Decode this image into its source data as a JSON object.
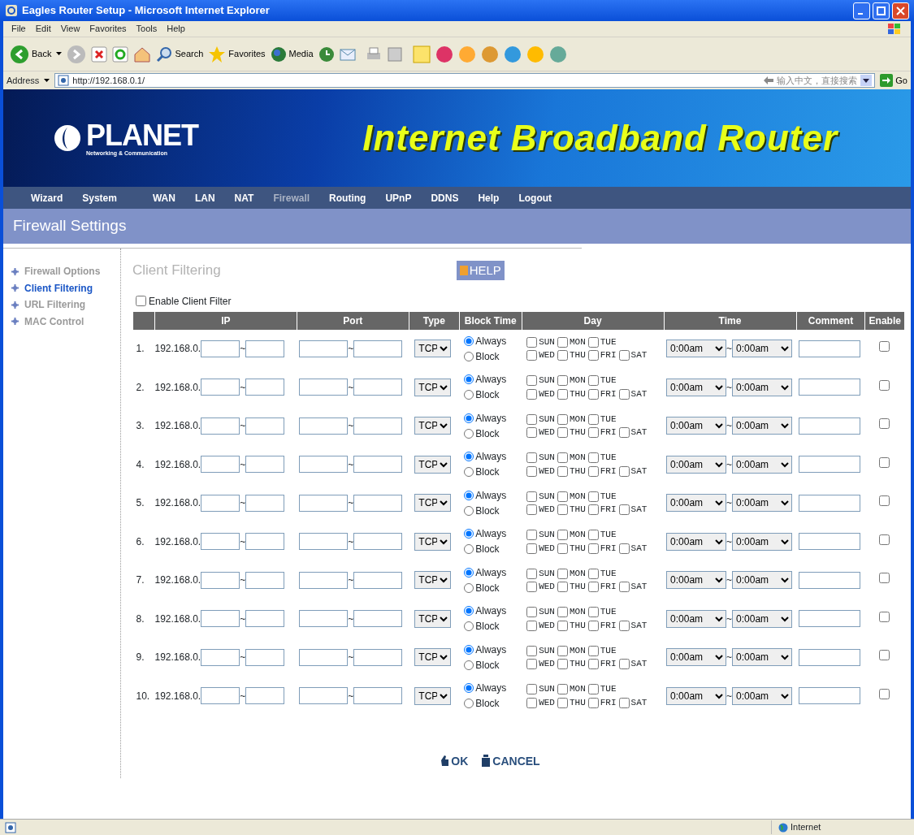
{
  "window": {
    "title": "Eagles Router Setup - Microsoft Internet Explorer"
  },
  "menu_bar": [
    "File",
    "Edit",
    "View",
    "Favorites",
    "Tools",
    "Help"
  ],
  "toolbar": [
    {
      "label": "Back"
    },
    {
      "label": "Search"
    },
    {
      "label": "Favorites"
    },
    {
      "label": "Media"
    }
  ],
  "address_bar": {
    "label": "Address",
    "url": "http://192.168.0.1/",
    "search_hint": "输入中文，直接搜索",
    "go": "Go"
  },
  "banner": {
    "logo": "PLANET",
    "tagline": "Networking & Communication",
    "headline": "Internet Broadband Router"
  },
  "nav": [
    {
      "label": "Wizard",
      "selected": false
    },
    {
      "label": "System",
      "selected": false
    },
    {
      "label": "WAN",
      "selected": false
    },
    {
      "label": "LAN",
      "selected": false
    },
    {
      "label": "NAT",
      "selected": false
    },
    {
      "label": "Firewall",
      "selected": true
    },
    {
      "label": "Routing",
      "selected": false
    },
    {
      "label": "UPnP",
      "selected": false
    },
    {
      "label": "DDNS",
      "selected": false
    },
    {
      "label": "Help",
      "selected": false
    },
    {
      "label": "Logout",
      "selected": false
    }
  ],
  "page_title": "Firewall Settings",
  "sidebar": [
    {
      "label": "Firewall Options",
      "selected": false
    },
    {
      "label": "Client Filtering",
      "selected": true
    },
    {
      "label": "URL Filtering",
      "selected": false
    },
    {
      "label": "MAC Control",
      "selected": false
    }
  ],
  "section_title": "Client Filtering",
  "help_button": "HELP",
  "enable_filter": {
    "label": "Enable Client Filter",
    "checked": false
  },
  "table": {
    "columns": [
      "IP",
      "Port",
      "Type",
      "Block Time",
      "Day",
      "Time",
      "Comment",
      "Enable"
    ],
    "rows": [
      {
        "index": "1.",
        "ip_prefix": "192.168.0.",
        "ip_sep": "~",
        "port_sep": "~",
        "type": "TCP",
        "block_time": [
          {
            "label": "Always",
            "selected": true
          },
          {
            "label": "Block",
            "selected": false
          }
        ],
        "days": [
          {
            "label": "SUN",
            "checked": false
          },
          {
            "label": "MON",
            "checked": false
          },
          {
            "label": "TUE",
            "checked": false
          },
          {
            "label": "WED",
            "checked": false
          },
          {
            "label": "THU",
            "checked": false
          },
          {
            "label": "FRI",
            "checked": false
          },
          {
            "label": "SAT",
            "checked": false
          }
        ],
        "time_from": "0:00am",
        "time_sep": "~",
        "time_to": "0:00am",
        "enabled": false
      },
      {
        "index": "2.",
        "ip_prefix": "192.168.0.",
        "ip_sep": "~",
        "port_sep": "~",
        "type": "TCP",
        "block_time": [
          {
            "label": "Always",
            "selected": true
          },
          {
            "label": "Block",
            "selected": false
          }
        ],
        "days": [
          {
            "label": "SUN",
            "checked": false
          },
          {
            "label": "MON",
            "checked": false
          },
          {
            "label": "TUE",
            "checked": false
          },
          {
            "label": "WED",
            "checked": false
          },
          {
            "label": "THU",
            "checked": false
          },
          {
            "label": "FRI",
            "checked": false
          },
          {
            "label": "SAT",
            "checked": false
          }
        ],
        "time_from": "0:00am",
        "time_sep": "~",
        "time_to": "0:00am",
        "enabled": false
      },
      {
        "index": "3.",
        "ip_prefix": "192.168.0.",
        "ip_sep": "~",
        "port_sep": "~",
        "type": "TCP",
        "block_time": [
          {
            "label": "Always",
            "selected": true
          },
          {
            "label": "Block",
            "selected": false
          }
        ],
        "days": [
          {
            "label": "SUN",
            "checked": false
          },
          {
            "label": "MON",
            "checked": false
          },
          {
            "label": "TUE",
            "checked": false
          },
          {
            "label": "WED",
            "checked": false
          },
          {
            "label": "THU",
            "checked": false
          },
          {
            "label": "FRI",
            "checked": false
          },
          {
            "label": "SAT",
            "checked": false
          }
        ],
        "time_from": "0:00am",
        "time_sep": "~",
        "time_to": "0:00am",
        "enabled": false
      },
      {
        "index": "4.",
        "ip_prefix": "192.168.0.",
        "ip_sep": "~",
        "port_sep": "~",
        "type": "TCP",
        "block_time": [
          {
            "label": "Always",
            "selected": true
          },
          {
            "label": "Block",
            "selected": false
          }
        ],
        "days": [
          {
            "label": "SUN",
            "checked": false
          },
          {
            "label": "MON",
            "checked": false
          },
          {
            "label": "TUE",
            "checked": false
          },
          {
            "label": "WED",
            "checked": false
          },
          {
            "label": "THU",
            "checked": false
          },
          {
            "label": "FRI",
            "checked": false
          },
          {
            "label": "SAT",
            "checked": false
          }
        ],
        "time_from": "0:00am",
        "time_sep": "~",
        "time_to": "0:00am",
        "enabled": false
      },
      {
        "index": "5.",
        "ip_prefix": "192.168.0.",
        "ip_sep": "~",
        "port_sep": "~",
        "type": "TCP",
        "block_time": [
          {
            "label": "Always",
            "selected": true
          },
          {
            "label": "Block",
            "selected": false
          }
        ],
        "days": [
          {
            "label": "SUN",
            "checked": false
          },
          {
            "label": "MON",
            "checked": false
          },
          {
            "label": "TUE",
            "checked": false
          },
          {
            "label": "WED",
            "checked": false
          },
          {
            "label": "THU",
            "checked": false
          },
          {
            "label": "FRI",
            "checked": false
          },
          {
            "label": "SAT",
            "checked": false
          }
        ],
        "time_from": "0:00am",
        "time_sep": "~",
        "time_to": "0:00am",
        "enabled": false
      },
      {
        "index": "6.",
        "ip_prefix": "192.168.0.",
        "ip_sep": "~",
        "port_sep": "~",
        "type": "TCP",
        "block_time": [
          {
            "label": "Always",
            "selected": true
          },
          {
            "label": "Block",
            "selected": false
          }
        ],
        "days": [
          {
            "label": "SUN",
            "checked": false
          },
          {
            "label": "MON",
            "checked": false
          },
          {
            "label": "TUE",
            "checked": false
          },
          {
            "label": "WED",
            "checked": false
          },
          {
            "label": "THU",
            "checked": false
          },
          {
            "label": "FRI",
            "checked": false
          },
          {
            "label": "SAT",
            "checked": false
          }
        ],
        "time_from": "0:00am",
        "time_sep": "~",
        "time_to": "0:00am",
        "enabled": false
      },
      {
        "index": "7.",
        "ip_prefix": "192.168.0.",
        "ip_sep": "~",
        "port_sep": "~",
        "type": "TCP",
        "block_time": [
          {
            "label": "Always",
            "selected": true
          },
          {
            "label": "Block",
            "selected": false
          }
        ],
        "days": [
          {
            "label": "SUN",
            "checked": false
          },
          {
            "label": "MON",
            "checked": false
          },
          {
            "label": "TUE",
            "checked": false
          },
          {
            "label": "WED",
            "checked": false
          },
          {
            "label": "THU",
            "checked": false
          },
          {
            "label": "FRI",
            "checked": false
          },
          {
            "label": "SAT",
            "checked": false
          }
        ],
        "time_from": "0:00am",
        "time_sep": "~",
        "time_to": "0:00am",
        "enabled": false
      },
      {
        "index": "8.",
        "ip_prefix": "192.168.0.",
        "ip_sep": "~",
        "port_sep": "~",
        "type": "TCP",
        "block_time": [
          {
            "label": "Always",
            "selected": true
          },
          {
            "label": "Block",
            "selected": false
          }
        ],
        "days": [
          {
            "label": "SUN",
            "checked": false
          },
          {
            "label": "MON",
            "checked": false
          },
          {
            "label": "TUE",
            "checked": false
          },
          {
            "label": "WED",
            "checked": false
          },
          {
            "label": "THU",
            "checked": false
          },
          {
            "label": "FRI",
            "checked": false
          },
          {
            "label": "SAT",
            "checked": false
          }
        ],
        "time_from": "0:00am",
        "time_sep": "~",
        "time_to": "0:00am",
        "enabled": false
      },
      {
        "index": "9.",
        "ip_prefix": "192.168.0.",
        "ip_sep": "~",
        "port_sep": "~",
        "type": "TCP",
        "block_time": [
          {
            "label": "Always",
            "selected": true
          },
          {
            "label": "Block",
            "selected": false
          }
        ],
        "days": [
          {
            "label": "SUN",
            "checked": false
          },
          {
            "label": "MON",
            "checked": false
          },
          {
            "label": "TUE",
            "checked": false
          },
          {
            "label": "WED",
            "checked": false
          },
          {
            "label": "THU",
            "checked": false
          },
          {
            "label": "FRI",
            "checked": false
          },
          {
            "label": "SAT",
            "checked": false
          }
        ],
        "time_from": "0:00am",
        "time_sep": "~",
        "time_to": "0:00am",
        "enabled": false
      },
      {
        "index": "10.",
        "ip_prefix": "192.168.0.",
        "ip_sep": "~",
        "port_sep": "~",
        "type": "TCP",
        "block_time": [
          {
            "label": "Always",
            "selected": true
          },
          {
            "label": "Block",
            "selected": false
          }
        ],
        "days": [
          {
            "label": "SUN",
            "checked": false
          },
          {
            "label": "MON",
            "checked": false
          },
          {
            "label": "TUE",
            "checked": false
          },
          {
            "label": "WED",
            "checked": false
          },
          {
            "label": "THU",
            "checked": false
          },
          {
            "label": "FRI",
            "checked": false
          },
          {
            "label": "SAT",
            "checked": false
          }
        ],
        "time_from": "0:00am",
        "time_sep": "~",
        "time_to": "0:00am",
        "enabled": false
      }
    ]
  },
  "buttons": [
    "OK",
    "CANCEL"
  ],
  "status_bar": {
    "zone": "Internet"
  }
}
